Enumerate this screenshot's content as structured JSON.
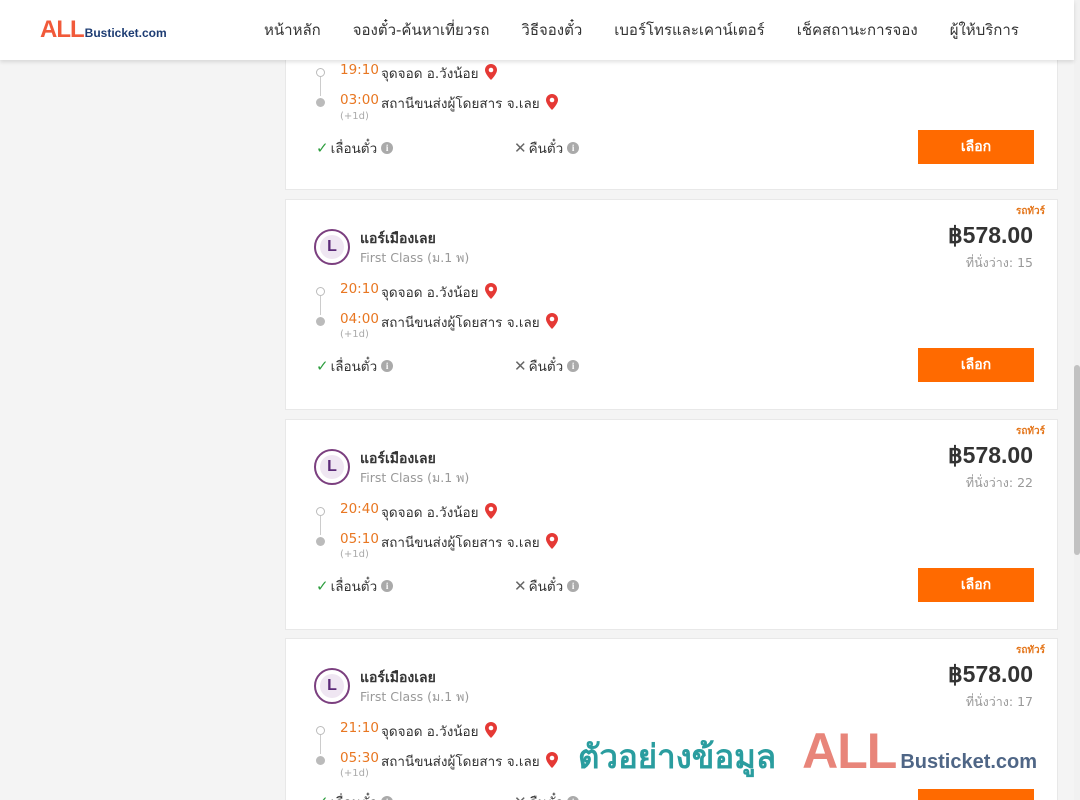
{
  "header": {
    "logo": {
      "all": "ALL",
      "rest": "Busticket.com"
    },
    "nav": [
      "หน้าหลัก",
      "จองตั๋ว-ค้นหาเที่ยวรถ",
      "วิธีจองตั๋ว",
      "เบอร์โทรและเคาน์เตอร์",
      "เช็คสถานะการจอง",
      "ผู้ให้บริการ"
    ]
  },
  "trips": [
    {
      "badge": "",
      "operator": "",
      "class": "",
      "price": "",
      "seats": "",
      "depart_time": "19:10",
      "depart_place": "จุดจอด อ.วังน้อย",
      "arrive_time": "03:00",
      "arrive_place": "สถานีขนส่งผู้โดยสาร จ.เลย",
      "next_day": "(+1d)",
      "change_label": "เลื่อนตั๋ว",
      "refund_label": "คืนตั๋ว",
      "button": "เลือก"
    },
    {
      "badge": "รถทัวร์",
      "operator": "แอร์เมืองเลย",
      "class": "First Class (ม.1 พ)",
      "price": "฿578.00",
      "seats": "ที่นั่งว่าง: 15",
      "depart_time": "20:10",
      "depart_place": "จุดจอด อ.วังน้อย",
      "arrive_time": "04:00",
      "arrive_place": "สถานีขนส่งผู้โดยสาร จ.เลย",
      "next_day": "(+1d)",
      "change_label": "เลื่อนตั๋ว",
      "refund_label": "คืนตั๋ว",
      "button": "เลือก"
    },
    {
      "badge": "รถทัวร์",
      "operator": "แอร์เมืองเลย",
      "class": "First Class (ม.1 พ)",
      "price": "฿578.00",
      "seats": "ที่นั่งว่าง: 22",
      "depart_time": "20:40",
      "depart_place": "จุดจอด อ.วังน้อย",
      "arrive_time": "05:10",
      "arrive_place": "สถานีขนส่งผู้โดยสาร จ.เลย",
      "next_day": "(+1d)",
      "change_label": "เลื่อนตั๋ว",
      "refund_label": "คืนตั๋ว",
      "button": "เลือก"
    },
    {
      "badge": "รถทัวร์",
      "operator": "แอร์เมืองเลย",
      "class": "First Class (ม.1 พ)",
      "price": "฿578.00",
      "seats": "ที่นั่งว่าง: 17",
      "depart_time": "21:10",
      "depart_place": "จุดจอด อ.วังน้อย",
      "arrive_time": "05:30",
      "arrive_place": "สถานีขนส่งผู้โดยสาร จ.เลย",
      "next_day": "(+1d)",
      "change_label": "เลื่อนตั๋ว",
      "refund_label": "คืนตั๋ว",
      "button": "เลือก"
    }
  ],
  "watermark": {
    "text": "ตัวอย่างข้อมูล",
    "all": "ALL",
    "rest": "Busticket.com"
  },
  "colors": {
    "accent": "#ff6a00",
    "time": "#e87722",
    "pin": "#e53935",
    "check": "#2e9e3f",
    "badge": "#e4761b"
  },
  "icons": {
    "pin": "map-pin-icon",
    "check": "check-icon",
    "cross": "cross-icon",
    "info": "info-icon"
  }
}
